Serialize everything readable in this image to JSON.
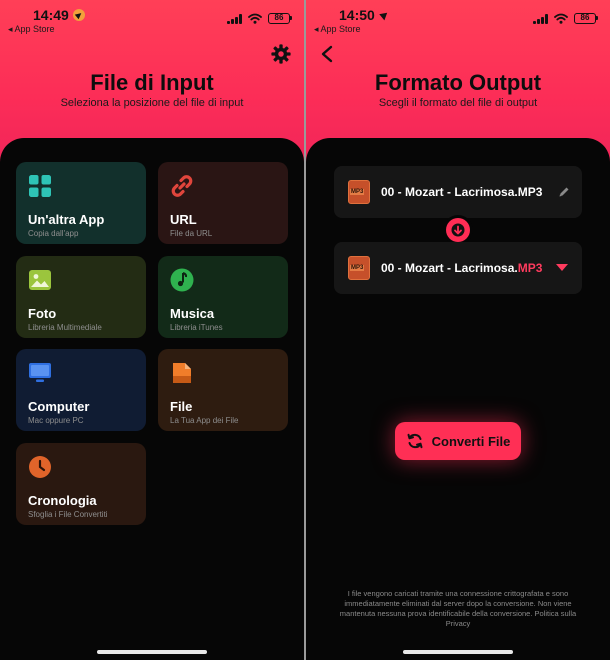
{
  "colors": {
    "accent": "#ff2d55",
    "hero_gradient_top": "#ff3f57",
    "hero_gradient_bottom": "#f0245a",
    "sheet_background": "#060606",
    "card_text_secondary": "#8e8e8e"
  },
  "left_screen": {
    "status": {
      "time": "14:49",
      "back_label": "◂ App Store",
      "battery": "86"
    },
    "header": {
      "title": "File di Input",
      "subtitle": "Seleziona la posizione del file di input"
    },
    "settings_icon": "gear-icon",
    "sources": [
      {
        "label": "Un'altra App",
        "sublabel": "Copia dall'app",
        "icon": "apps-grid-icon",
        "color": "#2ec4b6"
      },
      {
        "label": "URL",
        "sublabel": "File da URL",
        "icon": "link-icon",
        "color": "#e0453c"
      },
      {
        "label": "Foto",
        "sublabel": "Libreria Multimediale",
        "icon": "photo-icon",
        "color": "#9bc53d"
      },
      {
        "label": "Musica",
        "sublabel": "Libreria iTunes",
        "icon": "music-note-icon",
        "color": "#2fb24f"
      },
      {
        "label": "Computer",
        "sublabel": "Mac oppure PC",
        "icon": "monitor-icon",
        "color": "#2f6fe0"
      },
      {
        "label": "File",
        "sublabel": "La Tua App dei File",
        "icon": "file-icon",
        "color": "#f07d2a"
      },
      {
        "label": "Cronologia",
        "sublabel": "Sfoglia i File Convertiti",
        "icon": "clock-icon",
        "color": "#e0642a"
      }
    ]
  },
  "right_screen": {
    "status": {
      "time": "14:50",
      "back_label": "◂ App Store",
      "battery": "86"
    },
    "header": {
      "title": "Formato Output",
      "subtitle": "Scegli il formato del file di output"
    },
    "input_file": {
      "icon_text": "MP3",
      "name": "00 - Mozart - Lacrimosa.MP3"
    },
    "output_file": {
      "icon_text": "MP3",
      "name_base": "00 - Mozart - Lacrimosa.",
      "extension": "MP3"
    },
    "convert_button": {
      "label": "Converti File"
    },
    "disclaimer": "I file vengono caricati tramite una connessione crittografata e sono immediatamente eliminati dal server dopo la conversione. Non viene mantenuta nessuna prova identificabile della conversione. Politica sulla Privacy"
  }
}
